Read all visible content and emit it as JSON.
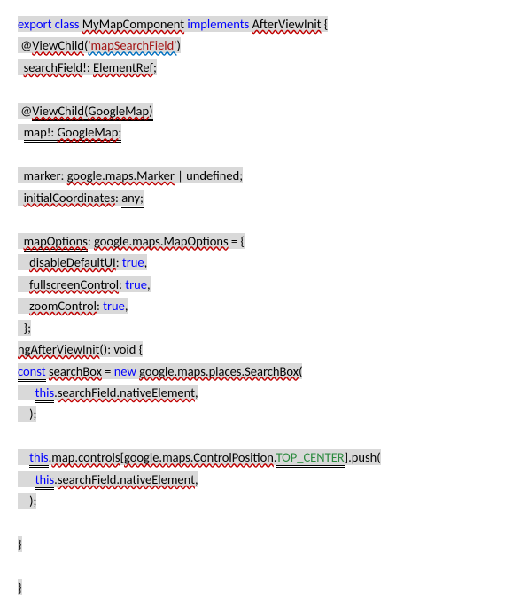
{
  "lines": {
    "l1": {
      "t1": "export class",
      "t2": " ",
      "t3": "MyMapComponent",
      "t4": " ",
      "t5": "implements",
      "t6": " ",
      "t7": "AfterViewInit",
      "t8": " {"
    },
    "l2": {
      "t1": " @",
      "t2": "ViewChild",
      "t3": "(",
      "t4": "'mapSearchField'",
      "t5": ")"
    },
    "l3": {
      "t1": "  ",
      "t2": "searchField",
      "t3": "!: ",
      "t4": "ElementRef",
      "t5": ";"
    },
    "l4": {
      "t1": " @",
      "t2": "ViewChild",
      "t3": "(",
      "t4": "GoogleMap",
      "t5": ")"
    },
    "l5": {
      "t1": "  ",
      "t2": "map!: ",
      "t3": "GoogleMap",
      "t4": ";"
    },
    "l6": {
      "t1": "  marker: ",
      "t2": "google.maps.Marker",
      "t3": " | undefined;"
    },
    "l7": {
      "t1": "  ",
      "t2": "initialCoordinates",
      "t3": ": ",
      "t4": "any;"
    },
    "l8": {
      "t1": "  ",
      "t2": "mapOptions",
      "t3": ": ",
      "t4": "google.maps.MapOptions",
      "t5": " = {"
    },
    "l9": {
      "t1": "    ",
      "t2": "disableDefaultUI",
      "t3": ": ",
      "t4": "true",
      "t5": ","
    },
    "l10": {
      "t1": "    ",
      "t2": "fullscreenControl",
      "t3": ": ",
      "t4": "true",
      "t5": ","
    },
    "l11": {
      "t1": "    ",
      "t2": "zoomControl",
      "t3": ": ",
      "t4": "true",
      "t5": ","
    },
    "l12": {
      "t1": "  };"
    },
    "l13": {
      "t1": "ngAfterViewInit",
      "t2": "(): void {"
    },
    "l14": {
      "t1": "const",
      "t2": " ",
      "t3": "searchBox",
      "t4": " = ",
      "t5": "new",
      "t6": " ",
      "t7": "google.maps.places.SearchBox",
      "t8": "("
    },
    "l15": {
      "t1": "      ",
      "t2": "this",
      "t3": ".",
      "t4": "searchField.nativeElement",
      "t5": ","
    },
    "l16": {
      "t1": "    );"
    },
    "l17": {
      "t1": "    ",
      "t2": "this",
      "t3": ".",
      "t4": "map.controls",
      "t5": "[",
      "t6": "google.maps.ControlPosition",
      "t7": ".",
      "t8": "TOP_CENTER",
      "t9": "].push("
    },
    "l18": {
      "t1": "      ",
      "t2": "this",
      "t3": ".",
      "t4": "searchField.nativeElement",
      "t5": ","
    },
    "l19": {
      "t1": "    );"
    },
    "l20": {
      "t1": "}"
    },
    "l21": {
      "t1": "}"
    }
  }
}
